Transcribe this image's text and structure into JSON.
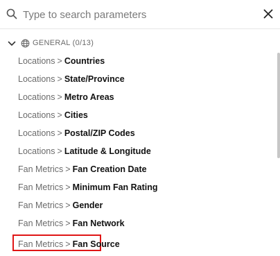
{
  "search": {
    "placeholder": "Type to search parameters",
    "value": ""
  },
  "icons": {
    "search": "search-icon",
    "close": "close-icon",
    "chevron": "chevron-down-icon",
    "globe": "globe-icon"
  },
  "group": {
    "label": "GENERAL (0/13)"
  },
  "items": [
    {
      "category": "Locations",
      "separator": ">",
      "name": "Countries"
    },
    {
      "category": "Locations",
      "separator": ">",
      "name": "State/Province"
    },
    {
      "category": "Locations",
      "separator": ">",
      "name": "Metro Areas"
    },
    {
      "category": "Locations",
      "separator": ">",
      "name": "Cities"
    },
    {
      "category": "Locations",
      "separator": ">",
      "name": "Postal/ZIP Codes"
    },
    {
      "category": "Locations",
      "separator": ">",
      "name": "Latitude & Longitude"
    },
    {
      "category": "Fan Metrics",
      "separator": ">",
      "name": "Fan Creation Date"
    },
    {
      "category": "Fan Metrics",
      "separator": ">",
      "name": "Minimum Fan Rating"
    },
    {
      "category": "Fan Metrics",
      "separator": ">",
      "name": "Gender"
    },
    {
      "category": "Fan Metrics",
      "separator": ">",
      "name": "Fan Network"
    },
    {
      "category": "Fan Metrics",
      "separator": ">",
      "name": "Fan Source"
    }
  ],
  "colors": {
    "highlight": "#e01515",
    "muted": "#6b6b6b",
    "text": "#111111"
  }
}
